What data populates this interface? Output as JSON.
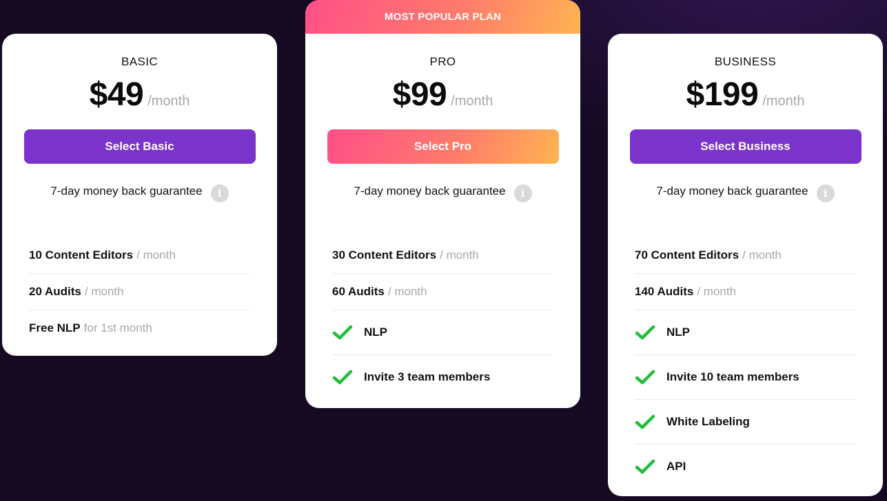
{
  "basic": {
    "name": "BASIC",
    "price": "$49",
    "period": "/month",
    "button": "Select Basic",
    "guarantee": "7-day money back guarantee",
    "features": [
      {
        "bold": "10 Content Editors",
        "muted": "/ month"
      },
      {
        "bold": "20 Audits",
        "muted": "/ month"
      },
      {
        "bold": "Free NLP",
        "muted": "for 1st month"
      }
    ]
  },
  "pro": {
    "banner": "MOST POPULAR PLAN",
    "name": "PRO",
    "price": "$99",
    "period": "/month",
    "button": "Select Pro",
    "guarantee": "7-day money back guarantee",
    "features": [
      {
        "bold": "30 Content Editors",
        "muted": "/ month"
      },
      {
        "bold": "60 Audits",
        "muted": "/ month"
      }
    ],
    "checks": [
      "NLP",
      "Invite 3 team members"
    ]
  },
  "business": {
    "name": "BUSINESS",
    "price": "$199",
    "period": "/month",
    "button": "Select Business",
    "guarantee": "7-day money back guarantee",
    "features": [
      {
        "bold": "70 Content Editors",
        "muted": "/ month"
      },
      {
        "bold": "140 Audits",
        "muted": "/ month"
      }
    ],
    "checks": [
      "NLP",
      "Invite 10 team members",
      "White Labeling",
      "API"
    ]
  },
  "colors": {
    "accent_purple": "#7a34cc",
    "check_green": "#1fbf3a",
    "background": "#150a22"
  },
  "icons": {
    "info": "info-icon",
    "check": "checkmark-icon"
  }
}
